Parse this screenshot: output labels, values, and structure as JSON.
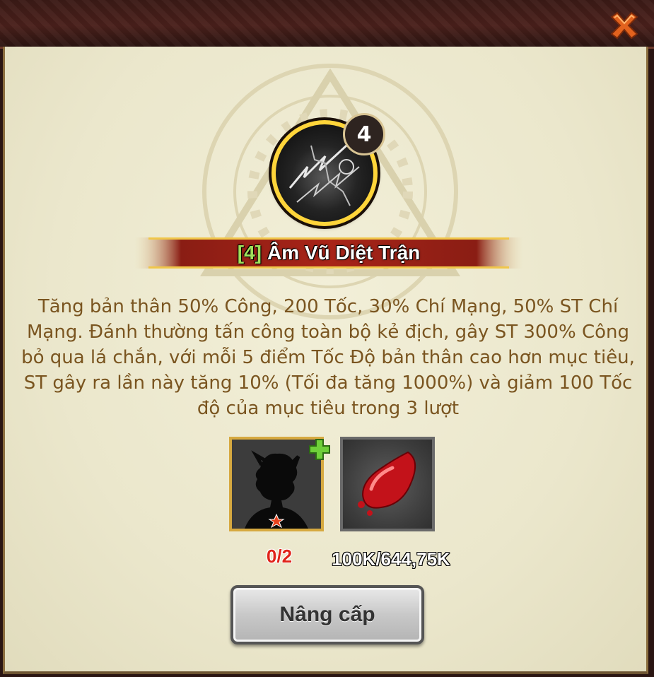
{
  "dialog": {
    "close_icon": "close-x-icon"
  },
  "skill": {
    "level_badge": "4",
    "title_level": "[4]",
    "title_name": "Âm Vũ Diệt Trận",
    "description": "Tăng bản thân 50% Công, 200 Tốc, 30% Chí Mạng, 50% ST Chí Mạng. Đánh thường tấn công toàn bộ kẻ địch, gây ST 300% Công bỏ qua lá chắn, với mỗi 5 điểm Tốc Độ bản thân cao hơn mục tiêu, ST gây ra lần này tăng 10% (Tối đa tăng 1000%) và giảm 100 Tốc độ của mục tiêu trong 3 lượt"
  },
  "requirements": {
    "character_count": "0/2",
    "item_count": "100K/644,75K"
  },
  "upgrade_button": {
    "label": "Nâng cấp"
  },
  "colors": {
    "title_level": "#9fe05a",
    "description": "#7a5520",
    "insufficient": "#e0241a",
    "frame_gold": "#d6a940"
  }
}
